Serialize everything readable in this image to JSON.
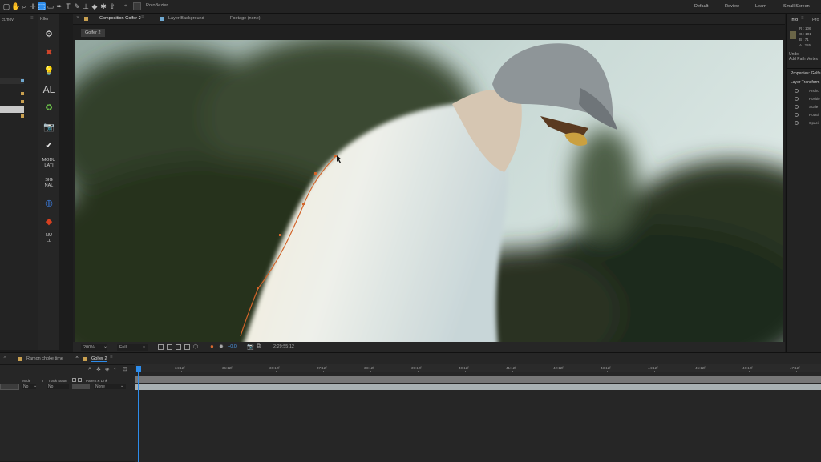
{
  "toolbar": {
    "tools": [
      "▢",
      "✋",
      "⌕",
      "✛",
      "⬚",
      "▭",
      "✒",
      "T",
      "✎",
      "⊥",
      "◆",
      "✱",
      "⇧"
    ],
    "active_index": 4,
    "rotobezier_label": "RotoBezier"
  },
  "workspaces": [
    "Default",
    "Review",
    "Learn",
    "Small Screen"
  ],
  "left_panel": {
    "title_fragment": "ct.mov"
  },
  "effects_panel": {
    "title": "Kller",
    "items": [
      {
        "type": "icon",
        "icon": "gear-icon",
        "glyph": "⚙",
        "color": "#d8d8d8"
      },
      {
        "type": "icon",
        "icon": "arrows-icon",
        "glyph": "✖",
        "color": "#d2452a"
      },
      {
        "type": "icon",
        "icon": "bulb-icon",
        "glyph": "💡",
        "color": "#e0a030"
      },
      {
        "type": "text",
        "text": "AL"
      },
      {
        "type": "icon",
        "icon": "recycle-icon",
        "glyph": "♻",
        "color": "#6cc24a"
      },
      {
        "type": "icon",
        "icon": "camera-icon",
        "glyph": "📷",
        "color": "#e0e0e0"
      },
      {
        "type": "icon",
        "icon": "check-icon",
        "glyph": "✔",
        "color": "#e8e8e8"
      },
      {
        "type": "text",
        "text": "MODU\nLATI"
      },
      {
        "type": "text",
        "text": "SIG\nNAL"
      },
      {
        "type": "icon",
        "icon": "globe-icon",
        "glyph": "◍",
        "color": "#3a78d8"
      },
      {
        "type": "icon",
        "icon": "diamond-icon",
        "glyph": "◆",
        "color": "#d84020"
      },
      {
        "type": "text",
        "text": "NU\nLL"
      }
    ]
  },
  "comp": {
    "tabs": [
      "Composition Golfer 2",
      "Layer Background",
      "Footage (none)"
    ],
    "breadcrumb": "Golfer 2"
  },
  "viewer_bar": {
    "zoom": "200%",
    "resolution": "Full",
    "exposure": "+0.0",
    "timecode": "2:29:55:12"
  },
  "info_panel": {
    "title": "Info",
    "tab2": "Pro",
    "r": "R : 106",
    "g": "G : 101",
    "b": "B : 71",
    "a": "A : 255",
    "undo": "Undo",
    "undo_action": "Add Path Vertex",
    "properties_title": "Properties: Golfe",
    "layer_transform": "Layer Transform",
    "props": [
      "Ancho",
      "Positio",
      "Scale",
      "Rotati",
      "Opacit"
    ]
  },
  "timeline": {
    "tabs": [
      "Ramon choke time",
      "Golfer 2"
    ],
    "columns": {
      "mode": "Mode",
      "t": "T",
      "track_matte": "Track Matte",
      "parent": "Parent & Link"
    },
    "row": {
      "mode": "No",
      "matte": "No",
      "parent": "None"
    },
    "ruler": [
      "34:12f",
      "35:12f",
      "36:12f",
      "37:12f",
      "38:12f",
      "39:12f",
      "40:12f",
      "41:12f",
      "42:12f",
      "43:12f",
      "44:12f",
      "45:12f",
      "46:12f",
      "47:12f"
    ]
  },
  "colors": {
    "accent": "#2d8ceb",
    "mask_path": "#d2642a"
  }
}
